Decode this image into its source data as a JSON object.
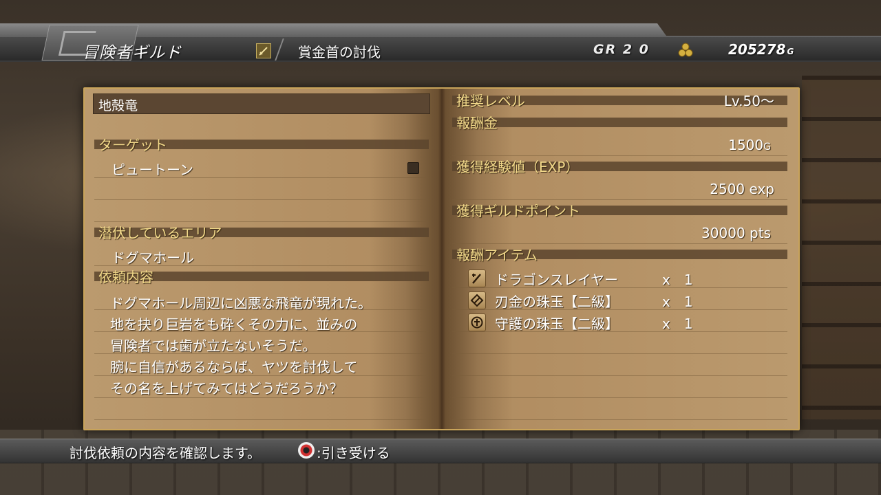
{
  "header": {
    "guild_title": "冒険者ギルド",
    "sub_title": "賞金首の討伐",
    "gr_label": "GR 2 0",
    "money": "205278",
    "money_unit": "G"
  },
  "quest": {
    "name": "地殻竜",
    "target_header": "ターゲット",
    "target": "ピュートーン",
    "area_header": "潜伏しているエリア",
    "area": "ドグマホール",
    "request_header": "依頼内容",
    "description": [
      "ドグマホール周辺に凶悪な飛竜が現れた。",
      "地を抉り巨岩をも砕くその力に、並みの",
      "冒険者では歯が立たないそうだ。",
      "腕に自信があるならば、ヤツを討伐して",
      "その名を上げてみてはどうだろうか？"
    ]
  },
  "rewards": {
    "level_header": "推奨レベル",
    "level": "Lv.50～",
    "money_header": "報酬金",
    "money_value": "1500",
    "money_unit": "G",
    "exp_header": "獲得経験値（EXP）",
    "exp_value": "2500",
    "exp_unit": "exp",
    "gp_header": "獲得ギルドポイント",
    "gp_value": "30000",
    "gp_unit": "pts",
    "items_header": "報酬アイテム",
    "items": [
      {
        "name": "ドラゴンスレイヤー",
        "qty": "x　1",
        "icon": "sword-icon"
      },
      {
        "name": "刃金の珠玉【二級】",
        "qty": "x　1",
        "icon": "blade-gem-icon"
      },
      {
        "name": "守護の珠玉【二級】",
        "qty": "x　1",
        "icon": "guard-gem-icon"
      }
    ]
  },
  "footer": {
    "help": "討伐依頼の内容を確認します。",
    "accept": ":引き受ける",
    "accept_icon": "circle-button-icon"
  }
}
